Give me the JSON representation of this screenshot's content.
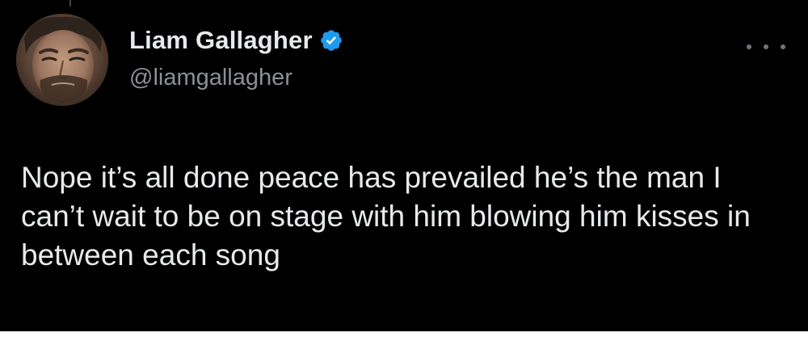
{
  "tweet": {
    "author": {
      "display_name": "Liam Gallagher",
      "handle": "@liamgallagher",
      "verified": true,
      "avatar_icon": "profile-photo"
    },
    "text": "Nope it’s all done peace has prevailed he’s the man I can’t wait to be on stage with him blowing him kisses in between each song",
    "more_icon": "ellipsis-icon"
  },
  "colors": {
    "background": "#000000",
    "primary_text": "#e7e9ea",
    "secondary_text": "#8b9096",
    "verified_badge": "#1d9bf0",
    "page_background": "#ffffff"
  }
}
